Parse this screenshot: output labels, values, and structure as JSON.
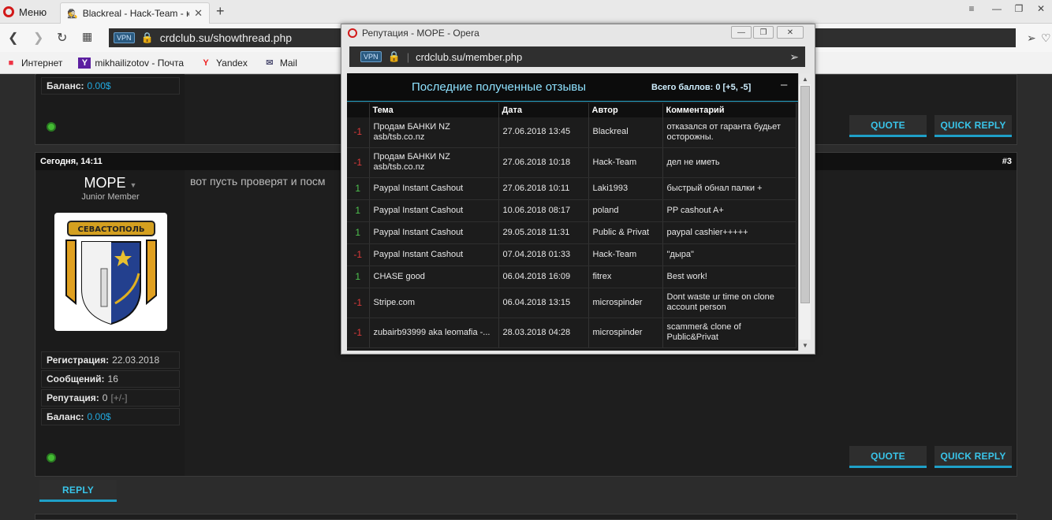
{
  "browser": {
    "menu_label": "Меню",
    "tab_title": "Blackreal - Hack-Team - к",
    "new_tab": "+",
    "vpn_badge": "VPN",
    "url": "crdclub.su/showthread.php",
    "bookmarks": [
      {
        "label": "Интернет",
        "icon": "windows-icon"
      },
      {
        "label": "mikhailizotov - Почта",
        "icon": "yahoo-icon"
      },
      {
        "label": "Yandex",
        "icon": "yandex-icon"
      },
      {
        "label": "Mail",
        "icon": "mail-icon"
      }
    ]
  },
  "forum": {
    "prev_post": {
      "balance_label": "Баланс:",
      "balance_value": "0.00$",
      "quote": "QUOTE",
      "quick_reply": "QUICK REPLY"
    },
    "post": {
      "date": "Сегодня, 14:11",
      "number": "#3",
      "username": "МОРЕ",
      "rank": "Junior Member",
      "text": "вот пусть проверят и посм",
      "reg_label": "Регистрация:",
      "reg_value": "22.03.2018",
      "msgs_label": "Сообщений:",
      "msgs_value": "16",
      "rep_label": "Репутация:",
      "rep_value": "0",
      "rep_extra": "[+/-]",
      "balance_label": "Баланс:",
      "balance_value": "0.00$",
      "quote": "QUOTE",
      "quick_reply": "QUICK REPLY",
      "avatar_text": "СЕВАСТОПОЛЬ"
    },
    "reply": "REPLY"
  },
  "popup": {
    "title": "Репутация - МОРЕ - Opera",
    "vpn_badge": "VPN",
    "url": "crdclub.su/member.php",
    "heading": "Последние полученные отзывы",
    "total": "Всего баллов: 0 [+5, -5]",
    "minimize": "–",
    "columns": [
      "Тема",
      "Дата",
      "Автор",
      "Комментарий"
    ],
    "rows": [
      {
        "score": "-1",
        "topic": "Продам БАНКИ NZ asb/tsb.co.nz",
        "date": "27.06.2018 13:45",
        "author": "Blackreal",
        "comment": "отказался от гаранта будьет осторожны."
      },
      {
        "score": "-1",
        "topic": "Продам БАНКИ NZ asb/tsb.co.nz",
        "date": "27.06.2018 10:18",
        "author": "Hack-Team",
        "comment": "дел не иметь"
      },
      {
        "score": "1",
        "topic": "Paypal Instant Cashout",
        "date": "27.06.2018 10:11",
        "author": "Laki1993",
        "comment": "быстрый обнал палки +"
      },
      {
        "score": "1",
        "topic": "Paypal Instant Cashout",
        "date": "10.06.2018 08:17",
        "author": "poland",
        "comment": "PP cashout A+"
      },
      {
        "score": "1",
        "topic": "Paypal Instant Cashout",
        "date": "29.05.2018 11:31",
        "author": "Public & Privat",
        "comment": "paypal cashier+++++"
      },
      {
        "score": "-1",
        "topic": "Paypal Instant Cashout",
        "date": "07.04.2018 01:33",
        "author": "Hack-Team",
        "comment": "\"дыра\""
      },
      {
        "score": "1",
        "topic": "CHASE good",
        "date": "06.04.2018 16:09",
        "author": "fitrex",
        "comment": "Best work!"
      },
      {
        "score": "-1",
        "topic": "Stripe.com",
        "date": "06.04.2018 13:15",
        "author": "microspinder",
        "comment": "Dont waste ur time on clone account person"
      },
      {
        "score": "-1",
        "topic": "zubairb93999 aka leomafia -...",
        "date": "28.03.2018 04:28",
        "author": "microspinder",
        "comment": "scammer& clone of Public&Privat"
      }
    ]
  },
  "colors": {
    "accent": "#1fa0c8",
    "positive": "#4ec24e",
    "negative": "#e03a3a",
    "link": "#22a9e0"
  }
}
